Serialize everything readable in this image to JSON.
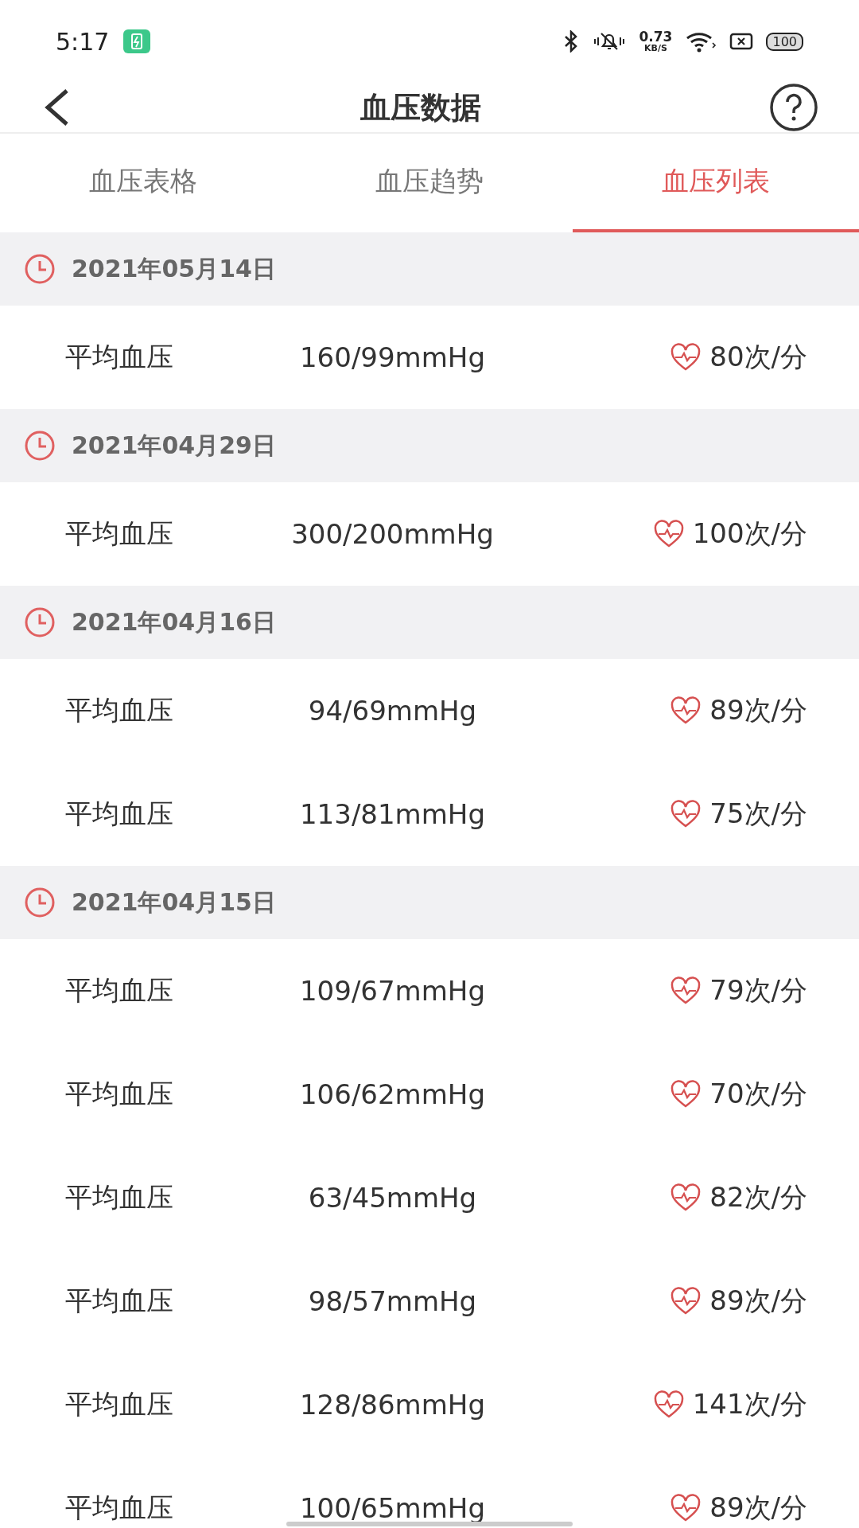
{
  "status_bar": {
    "time": "5:17",
    "net_speed": "0.73",
    "net_unit": "KB/S",
    "battery": "100"
  },
  "header": {
    "title": "血压数据"
  },
  "tabs": [
    {
      "label": "血压表格",
      "selected": false
    },
    {
      "label": "血压趋势",
      "selected": false
    },
    {
      "label": "血压列表",
      "selected": true
    }
  ],
  "groups": [
    {
      "date": "2021年05月14日",
      "rows": [
        {
          "label": "平均血压",
          "pressure": "160/99mmHg",
          "rate": "80次/分"
        }
      ]
    },
    {
      "date": "2021年04月29日",
      "rows": [
        {
          "label": "平均血压",
          "pressure": "300/200mmHg",
          "rate": "100次/分"
        }
      ]
    },
    {
      "date": "2021年04月16日",
      "rows": [
        {
          "label": "平均血压",
          "pressure": "94/69mmHg",
          "rate": "89次/分"
        },
        {
          "label": "平均血压",
          "pressure": "113/81mmHg",
          "rate": "75次/分"
        }
      ]
    },
    {
      "date": "2021年04月15日",
      "rows": [
        {
          "label": "平均血压",
          "pressure": "109/67mmHg",
          "rate": "79次/分"
        },
        {
          "label": "平均血压",
          "pressure": "106/62mmHg",
          "rate": "70次/分"
        },
        {
          "label": "平均血压",
          "pressure": "63/45mmHg",
          "rate": "82次/分"
        },
        {
          "label": "平均血压",
          "pressure": "98/57mmHg",
          "rate": "89次/分"
        },
        {
          "label": "平均血压",
          "pressure": "128/86mmHg",
          "rate": "141次/分"
        },
        {
          "label": "平均血压",
          "pressure": "100/65mmHg",
          "rate": "89次/分"
        }
      ]
    }
  ]
}
